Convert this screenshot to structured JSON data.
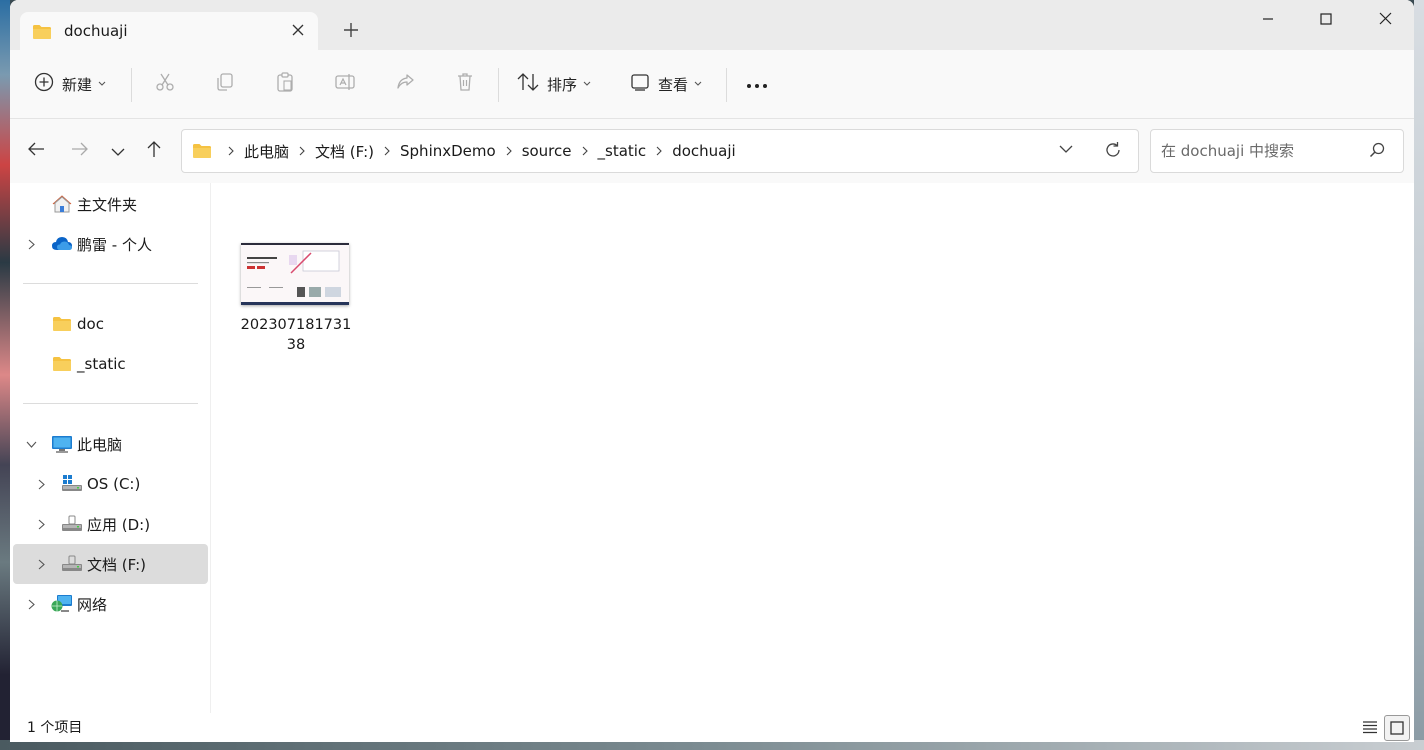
{
  "window": {
    "tab_title": "dochuaji",
    "new_tab_symbol": "+"
  },
  "toolbar": {
    "new_label": "新建",
    "sort_label": "排序",
    "view_label": "查看",
    "more_symbol": "•••",
    "icons": [
      "cut-icon",
      "copy-icon",
      "paste-icon",
      "rename-icon",
      "share-icon",
      "delete-icon"
    ]
  },
  "address": {
    "crumbs": [
      "此电脑",
      "文档 (F:)",
      "SphinxDemo",
      "source",
      "_static",
      "dochuaji"
    ]
  },
  "search": {
    "placeholder": "在 dochuaji 中搜索"
  },
  "sidebar": {
    "home": "主文件夹",
    "onedrive": "鹏雷 - 个人",
    "folders": [
      "doc",
      "_static"
    ],
    "this_pc": "此电脑",
    "drives": [
      "OS (C:)",
      "应用 (D:)",
      "文档 (F:)"
    ],
    "network": "网络",
    "selected": "文档 (F:)"
  },
  "content": {
    "files": [
      {
        "name": "20230718173138",
        "type": "image"
      }
    ]
  },
  "status": {
    "item_count": "1 个项目"
  },
  "colors": {
    "folder": "#f5c242",
    "accent": "#0067c0",
    "selected_bg": "#dcdcdc"
  }
}
